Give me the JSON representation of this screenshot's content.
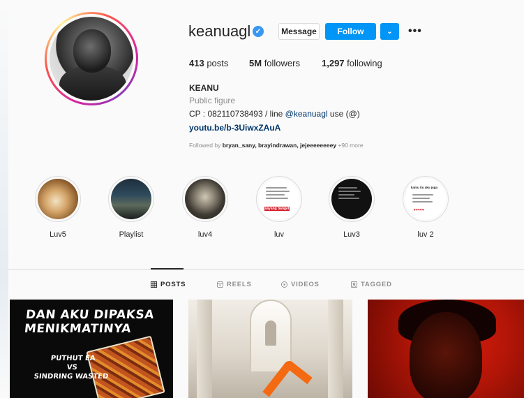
{
  "profile": {
    "username": "keanuagl",
    "verified": true,
    "buttons": {
      "message": "Message",
      "follow": "Follow",
      "more": "•••"
    },
    "stats": {
      "posts": "413",
      "posts_label": "posts",
      "followers": "5M",
      "followers_label": "followers",
      "following": "1,297",
      "following_label": "following"
    },
    "full_name": "KEANU",
    "category": "Public figure",
    "bio_prefix": "CP : 082110738493 / line ",
    "bio_mention": "@keanuagl",
    "bio_suffix": " use (@)",
    "link": "youtu.be/b-3UiwxZAuA",
    "followed_by_prefix": "Followed by ",
    "followed_by_names": "bryan_sany, brayindrawan, jejeeeeeeeey",
    "followed_by_more": " +90 more"
  },
  "highlights": [
    {
      "label": "Luv5"
    },
    {
      "label": "Playlist"
    },
    {
      "label": "luv4"
    },
    {
      "label": "luv"
    },
    {
      "label": "Luv3"
    },
    {
      "label": "luv 2"
    }
  ],
  "highlight_notes": {
    "luv_banner": "sayang banget",
    "luv2_top": "kamu itu aku juga"
  },
  "tabs": [
    {
      "label": "POSTS",
      "icon": "grid-icon",
      "active": true
    },
    {
      "label": "REELS",
      "icon": "reels-icon",
      "active": false
    },
    {
      "label": "VIDEOS",
      "icon": "play-icon",
      "active": false
    },
    {
      "label": "TAGGED",
      "icon": "tag-icon",
      "active": false
    }
  ],
  "posts": [
    {
      "title": "DAN AKU DIPAKSA MENIKMATINYA",
      "subtitle_line1": "PUTHUT EA",
      "subtitle_line2": "VS",
      "subtitle_line3": "SINDRING WASTED"
    },
    {
      "title": ""
    },
    {
      "title": ""
    }
  ],
  "colors": {
    "accent": "#0095f6",
    "verified": "#3897f0",
    "link": "#00376b",
    "muted": "#8e8e8e"
  }
}
